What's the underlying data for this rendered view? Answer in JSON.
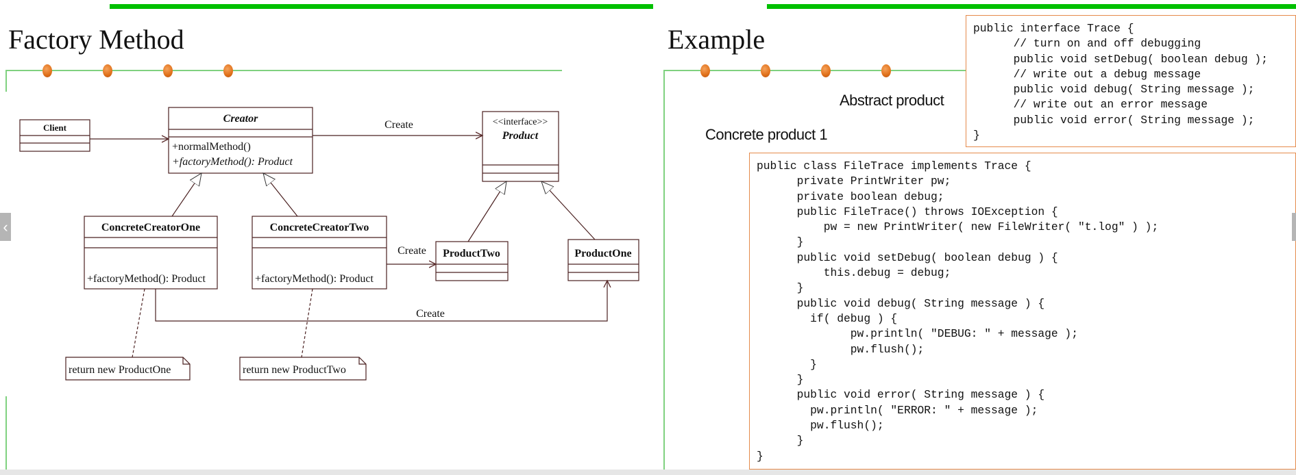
{
  "left_slide": {
    "title": "Factory Method",
    "diagram": {
      "client": "Client",
      "creator": {
        "name": "Creator",
        "methods": [
          "+normalMethod()",
          "+factoryMethod(): Product"
        ]
      },
      "product": {
        "stereotype": "<<interface>>",
        "name": "Product"
      },
      "concrete_creator_one": {
        "name": "ConcreteCreatorOne",
        "method": "+factoryMethod(): Product"
      },
      "concrete_creator_two": {
        "name": "ConcreteCreatorTwo",
        "method": "+factoryMethod(): Product"
      },
      "product_two": "ProductTwo",
      "product_one": "ProductOne",
      "create_label_top": "Create",
      "create_label_mid": "Create",
      "create_label_bottom": "Create",
      "note_one": "return new ProductOne",
      "note_two": "return new ProductTwo"
    }
  },
  "right_slide": {
    "title": "Example",
    "abstract_label": "Abstract product",
    "concrete_label": "Concrete product 1",
    "interface_code": [
      "public interface Trace {",
      "      // turn on and off debugging",
      "      public void setDebug( boolean debug );",
      "      // write out a debug message",
      "      public void debug( String message );",
      "      // write out an error message",
      "      public void error( String message );",
      "}"
    ],
    "class_code": [
      "public class FileTrace implements Trace {",
      "      private PrintWriter pw;",
      "      private boolean debug;",
      "      public FileTrace() throws IOException {",
      "          pw = new PrintWriter( new FileWriter( \"t.log\" ) );",
      "      }",
      "      public void setDebug( boolean debug ) {",
      "          this.debug = debug;",
      "      }",
      "      public void debug( String message ) {",
      "        if( debug ) {",
      "              pw.println( \"DEBUG: \" + message );",
      "              pw.flush();",
      "        }",
      "      }",
      "      public void error( String message ) {",
      "        pw.println( \"ERROR: \" + message );",
      "        pw.flush();",
      "      }",
      "}"
    ]
  },
  "nav": {
    "prev_icon": "chevron-left-icon",
    "next_icon": "chevron-right-icon",
    "prev_glyph": "‹"
  },
  "colors": {
    "accent_green": "#00c000",
    "dot_orange": "#e0701a",
    "code_border": "#e58a4a"
  }
}
